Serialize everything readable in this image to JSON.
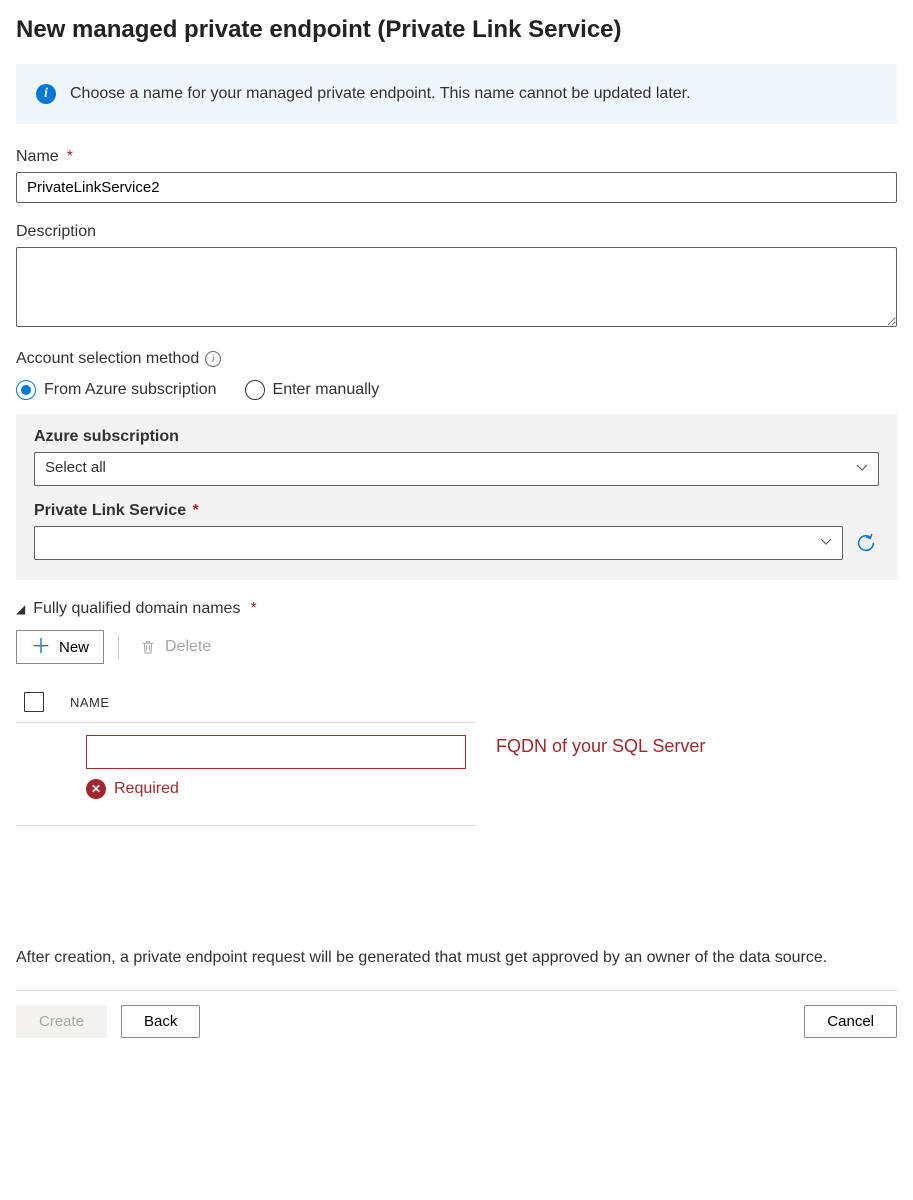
{
  "title": "New managed private endpoint (Private Link Service)",
  "info_banner": "Choose a name for your managed private endpoint. This name cannot be updated later.",
  "fields": {
    "name_label": "Name",
    "name_value": "PrivateLinkService2",
    "description_label": "Description",
    "description_value": "",
    "account_method_label": "Account selection method",
    "radio_from_azure": "From Azure subscription",
    "radio_manual": "Enter manually",
    "azure_sub_label": "Azure subscription",
    "azure_sub_value": "Select all",
    "pls_label": "Private Link Service",
    "pls_value": "",
    "fqdn_section": "Fully qualified domain names"
  },
  "toolbar": {
    "new_label": "New",
    "delete_label": "Delete"
  },
  "table": {
    "col_name": "NAME",
    "error_text": "Required"
  },
  "annotation": "FQDN of your SQL Server",
  "footer_note": "After creation, a private endpoint request will be generated that must get approved by an owner of the data source.",
  "buttons": {
    "create": "Create",
    "back": "Back",
    "cancel": "Cancel"
  }
}
